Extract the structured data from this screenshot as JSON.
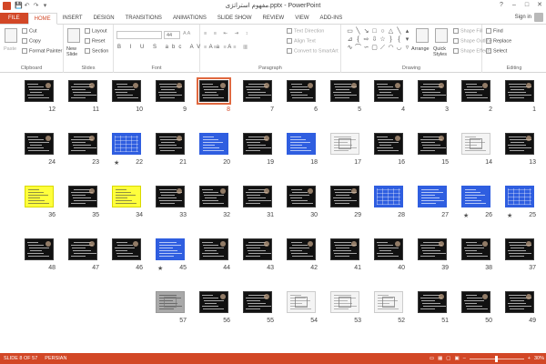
{
  "window": {
    "title": "مفهوم استراتژی.pptx - PowerPoint",
    "help": "?",
    "minimize": "–",
    "maximize": "□",
    "close": "✕"
  },
  "qat": {
    "save": "💾",
    "undo": "↶",
    "redo": "↷",
    "customize": "▾"
  },
  "tabs": [
    "FILE",
    "HOME",
    "INSERT",
    "DESIGN",
    "TRANSITIONS",
    "ANIMATIONS",
    "SLIDE SHOW",
    "REVIEW",
    "VIEW",
    "ADD-INS"
  ],
  "active_tab": "HOME",
  "sign_in": "Sign in",
  "ribbon": {
    "clipboard": {
      "label": "Clipboard",
      "paste": "Paste",
      "cut": "Cut",
      "copy": "Copy",
      "format_painter": "Format Painter"
    },
    "slides": {
      "label": "Slides",
      "new_slide": "New Slide",
      "layout": "Layout",
      "reset": "Reset",
      "section": "Section"
    },
    "font": {
      "label": "Font",
      "font_name": "",
      "font_size": "44",
      "format_buttons": "B I U S abc AV Aa A"
    },
    "paragraph": {
      "label": "Paragraph",
      "text_direction": "Text Direction",
      "align_text": "Align Text",
      "convert_smartart": "Convert to SmartArt"
    },
    "drawing": {
      "label": "Drawing",
      "arrange": "Arrange",
      "quick_styles": "Quick Styles",
      "shape_fill": "Shape Fill",
      "shape_outline": "Shape Outline",
      "shape_effects": "Shape Effects"
    },
    "editing": {
      "label": "Editing",
      "find": "Find",
      "replace": "Replace",
      "select": "Select"
    }
  },
  "slides": [
    {
      "n": "1",
      "style": "dark"
    },
    {
      "n": "2",
      "style": "dark"
    },
    {
      "n": "3",
      "style": "dark"
    },
    {
      "n": "4",
      "style": "dark"
    },
    {
      "n": "5",
      "style": "dark"
    },
    {
      "n": "6",
      "style": "dark"
    },
    {
      "n": "7",
      "style": "dark"
    },
    {
      "n": "8",
      "style": "dark",
      "selected": true
    },
    {
      "n": "9",
      "style": "dark"
    },
    {
      "n": "10",
      "style": "dark"
    },
    {
      "n": "11",
      "style": "dark"
    },
    {
      "n": "12",
      "style": "dark"
    },
    {
      "n": "13",
      "style": "dark"
    },
    {
      "n": "14",
      "style": "white"
    },
    {
      "n": "15",
      "style": "dark"
    },
    {
      "n": "16",
      "style": "dark"
    },
    {
      "n": "17",
      "style": "white"
    },
    {
      "n": "18",
      "style": "blue"
    },
    {
      "n": "19",
      "style": "dark"
    },
    {
      "n": "20",
      "style": "blue"
    },
    {
      "n": "21",
      "style": "dark"
    },
    {
      "n": "22",
      "style": "blue",
      "star": true
    },
    {
      "n": "23",
      "style": "dark"
    },
    {
      "n": "24",
      "style": "dark"
    },
    {
      "n": "25",
      "style": "blue",
      "star": true
    },
    {
      "n": "26",
      "style": "blue",
      "star": true
    },
    {
      "n": "27",
      "style": "blue"
    },
    {
      "n": "28",
      "style": "blue"
    },
    {
      "n": "29",
      "style": "dark"
    },
    {
      "n": "30",
      "style": "dark"
    },
    {
      "n": "31",
      "style": "dark"
    },
    {
      "n": "32",
      "style": "dark"
    },
    {
      "n": "33",
      "style": "dark"
    },
    {
      "n": "34",
      "style": "yellow"
    },
    {
      "n": "35",
      "style": "dark"
    },
    {
      "n": "36",
      "style": "yellow"
    },
    {
      "n": "37",
      "style": "dark"
    },
    {
      "n": "38",
      "style": "dark"
    },
    {
      "n": "39",
      "style": "dark"
    },
    {
      "n": "40",
      "style": "dark"
    },
    {
      "n": "41",
      "style": "dark"
    },
    {
      "n": "42",
      "style": "dark"
    },
    {
      "n": "43",
      "style": "dark"
    },
    {
      "n": "44",
      "style": "dark"
    },
    {
      "n": "45",
      "style": "blue",
      "star": true
    },
    {
      "n": "46",
      "style": "dark"
    },
    {
      "n": "47",
      "style": "dark"
    },
    {
      "n": "48",
      "style": "dark"
    },
    {
      "n": "49",
      "style": "dark"
    },
    {
      "n": "50",
      "style": "dark"
    },
    {
      "n": "51",
      "style": "dark"
    },
    {
      "n": "52",
      "style": "white"
    },
    {
      "n": "53",
      "style": "white"
    },
    {
      "n": "54",
      "style": "white"
    },
    {
      "n": "55",
      "style": "dark"
    },
    {
      "n": "56",
      "style": "dark"
    },
    {
      "n": "57",
      "style": "photo"
    }
  ],
  "status": {
    "slide_indicator": "SLIDE 8 OF 57",
    "language": "PERSIAN",
    "zoom_minus": "–",
    "zoom_plus": "+",
    "zoom": "30%"
  },
  "colors": {
    "accent": "#d24726",
    "selection": "#e0683f",
    "blue_slide": "#2f5ee0",
    "yellow_slide": "#ffff3c"
  }
}
